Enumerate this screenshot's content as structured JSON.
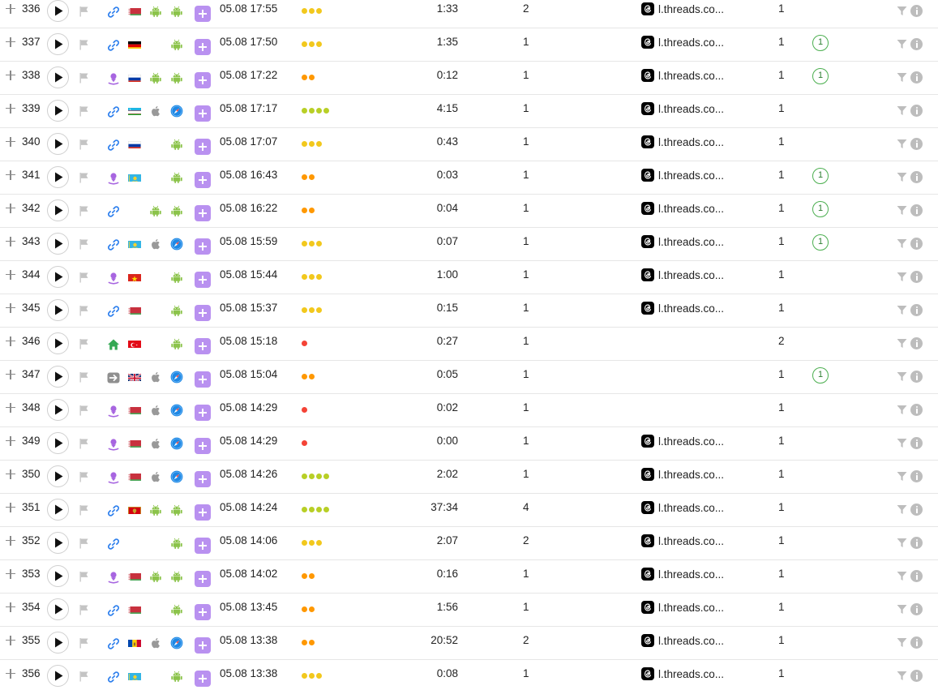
{
  "colors": {
    "dot_red": "#f44336",
    "dot_orange": "#ff9800",
    "dot_yellow": "#f2c81d",
    "dot_green": "#b8cf26",
    "accent_purple": "#b991f0",
    "badge_green": "#4caf50"
  },
  "icons": {
    "expand": "plus-icon",
    "play": "play-icon",
    "flag": "flag-icon",
    "sources": [
      "link-icon",
      "person-pin-icon",
      "home-icon",
      "arrow-right-icon"
    ],
    "os": [
      "android-icon",
      "apple-icon"
    ],
    "browser": [
      "safari-icon",
      "android-icon"
    ],
    "add": "add-icon",
    "referrer": "threads-icon",
    "filter": "filter-icon",
    "info": "info-icon"
  },
  "rows": [
    {
      "num": "336",
      "src": "link",
      "country": "by",
      "os": "android",
      "browser": "android",
      "datetime": "05.08 17:55",
      "dots": 3,
      "dot_color": "yellow",
      "duration": "1:33",
      "views": "2",
      "referrer": "l.threads.co...",
      "count": "1",
      "badge": ""
    },
    {
      "num": "337",
      "src": "link",
      "country": "de",
      "os": "",
      "browser": "android",
      "datetime": "05.08 17:50",
      "dots": 3,
      "dot_color": "yellow",
      "duration": "1:35",
      "views": "1",
      "referrer": "l.threads.co...",
      "count": "1",
      "badge": "1"
    },
    {
      "num": "338",
      "src": "person",
      "country": "ru",
      "os": "android",
      "browser": "android",
      "datetime": "05.08 17:22",
      "dots": 2,
      "dot_color": "orange",
      "duration": "0:12",
      "views": "1",
      "referrer": "l.threads.co...",
      "count": "1",
      "badge": "1"
    },
    {
      "num": "339",
      "src": "link",
      "country": "uz",
      "os": "apple",
      "browser": "safari",
      "datetime": "05.08 17:17",
      "dots": 4,
      "dot_color": "green",
      "duration": "4:15",
      "views": "1",
      "referrer": "l.threads.co...",
      "count": "1",
      "badge": ""
    },
    {
      "num": "340",
      "src": "link",
      "country": "ru",
      "os": "",
      "browser": "android",
      "datetime": "05.08 17:07",
      "dots": 3,
      "dot_color": "yellow",
      "duration": "0:43",
      "views": "1",
      "referrer": "l.threads.co...",
      "count": "1",
      "badge": ""
    },
    {
      "num": "341",
      "src": "person",
      "country": "kz",
      "os": "",
      "browser": "android",
      "datetime": "05.08 16:43",
      "dots": 2,
      "dot_color": "orange",
      "duration": "0:03",
      "views": "1",
      "referrer": "l.threads.co...",
      "count": "1",
      "badge": "1"
    },
    {
      "num": "342",
      "src": "link",
      "country": "",
      "os": "android",
      "browser": "android",
      "datetime": "05.08 16:22",
      "dots": 2,
      "dot_color": "orange",
      "duration": "0:04",
      "views": "1",
      "referrer": "l.threads.co...",
      "count": "1",
      "badge": "1"
    },
    {
      "num": "343",
      "src": "link",
      "country": "kz",
      "os": "apple",
      "browser": "safari",
      "datetime": "05.08 15:59",
      "dots": 3,
      "dot_color": "yellow",
      "duration": "0:07",
      "views": "1",
      "referrer": "l.threads.co...",
      "count": "1",
      "badge": "1"
    },
    {
      "num": "344",
      "src": "person",
      "country": "vn",
      "os": "",
      "browser": "android",
      "datetime": "05.08 15:44",
      "dots": 3,
      "dot_color": "yellow",
      "duration": "1:00",
      "views": "1",
      "referrer": "l.threads.co...",
      "count": "1",
      "badge": ""
    },
    {
      "num": "345",
      "src": "link",
      "country": "by",
      "os": "",
      "browser": "android",
      "datetime": "05.08 15:37",
      "dots": 3,
      "dot_color": "yellow",
      "duration": "0:15",
      "views": "1",
      "referrer": "l.threads.co...",
      "count": "1",
      "badge": ""
    },
    {
      "num": "346",
      "src": "home",
      "country": "tr",
      "os": "",
      "browser": "android",
      "datetime": "05.08 15:18",
      "dots": 1,
      "dot_color": "red",
      "duration": "0:27",
      "views": "1",
      "referrer": "",
      "count": "2",
      "badge": ""
    },
    {
      "num": "347",
      "src": "arrow",
      "country": "gb",
      "os": "apple",
      "browser": "safari",
      "datetime": "05.08 15:04",
      "dots": 2,
      "dot_color": "orange",
      "duration": "0:05",
      "views": "1",
      "referrer": "",
      "count": "1",
      "badge": "1"
    },
    {
      "num": "348",
      "src": "person",
      "country": "by",
      "os": "apple",
      "browser": "safari",
      "datetime": "05.08 14:29",
      "dots": 1,
      "dot_color": "red",
      "duration": "0:02",
      "views": "1",
      "referrer": "",
      "count": "1",
      "badge": ""
    },
    {
      "num": "349",
      "src": "person",
      "country": "by",
      "os": "apple",
      "browser": "safari",
      "datetime": "05.08 14:29",
      "dots": 1,
      "dot_color": "red",
      "duration": "0:00",
      "views": "1",
      "referrer": "l.threads.co...",
      "count": "1",
      "badge": ""
    },
    {
      "num": "350",
      "src": "person",
      "country": "by",
      "os": "apple",
      "browser": "safari",
      "datetime": "05.08 14:26",
      "dots": 4,
      "dot_color": "green",
      "duration": "2:02",
      "views": "1",
      "referrer": "l.threads.co...",
      "count": "1",
      "badge": ""
    },
    {
      "num": "351",
      "src": "link",
      "country": "me",
      "os": "android",
      "browser": "android",
      "datetime": "05.08 14:24",
      "dots": 4,
      "dot_color": "green",
      "duration": "37:34",
      "views": "4",
      "referrer": "l.threads.co...",
      "count": "1",
      "badge": ""
    },
    {
      "num": "352",
      "src": "link",
      "country": "",
      "os": "",
      "browser": "android",
      "datetime": "05.08 14:06",
      "dots": 3,
      "dot_color": "yellow",
      "duration": "2:07",
      "views": "2",
      "referrer": "l.threads.co...",
      "count": "1",
      "badge": ""
    },
    {
      "num": "353",
      "src": "person",
      "country": "by",
      "os": "android",
      "browser": "android",
      "datetime": "05.08 14:02",
      "dots": 2,
      "dot_color": "orange",
      "duration": "0:16",
      "views": "1",
      "referrer": "l.threads.co...",
      "count": "1",
      "badge": ""
    },
    {
      "num": "354",
      "src": "link",
      "country": "by",
      "os": "",
      "browser": "android",
      "datetime": "05.08 13:45",
      "dots": 2,
      "dot_color": "orange",
      "duration": "1:56",
      "views": "1",
      "referrer": "l.threads.co...",
      "count": "1",
      "badge": ""
    },
    {
      "num": "355",
      "src": "link",
      "country": "md",
      "os": "apple",
      "browser": "safari",
      "datetime": "05.08 13:38",
      "dots": 2,
      "dot_color": "orange",
      "duration": "20:52",
      "views": "2",
      "referrer": "l.threads.co...",
      "count": "1",
      "badge": ""
    },
    {
      "num": "356",
      "src": "link",
      "country": "kz",
      "os": "",
      "browser": "android",
      "datetime": "05.08 13:38",
      "dots": 3,
      "dot_color": "yellow",
      "duration": "0:08",
      "views": "1",
      "referrer": "l.threads.co...",
      "count": "1",
      "badge": ""
    }
  ]
}
